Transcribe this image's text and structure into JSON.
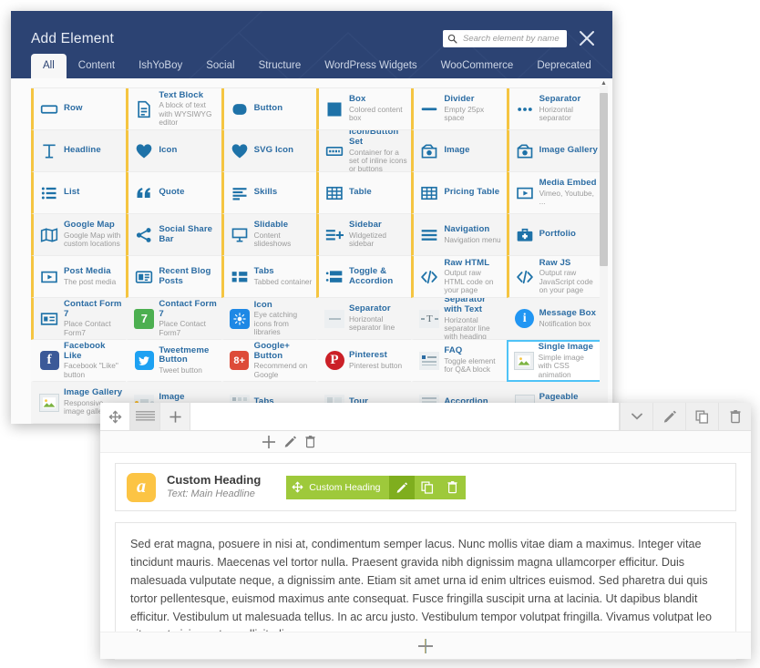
{
  "modal": {
    "title": "Add Element",
    "close_label": "×",
    "close_icon": "close-icon",
    "search": {
      "placeholder": "Search element by name",
      "value": "",
      "icon": "search-icon"
    },
    "tabs": [
      {
        "label": "All",
        "active": true
      },
      {
        "label": "Content",
        "active": false
      },
      {
        "label": "IshYoBoy",
        "active": false
      },
      {
        "label": "Social",
        "active": false
      },
      {
        "label": "Structure",
        "active": false
      },
      {
        "label": "WordPress Widgets",
        "active": false
      },
      {
        "label": "WooCommerce",
        "active": false
      },
      {
        "label": "Deprecated",
        "active": false
      }
    ],
    "accent_color": "#f5c541",
    "header_color": "#2c4373",
    "link_color": "#2b6ca3",
    "selected_outline_color": "#4fc3f7",
    "elements": [
      {
        "name": "Row",
        "desc": "",
        "icon": "row-icon",
        "accent": true
      },
      {
        "name": "Text Block",
        "desc": "A block of text with WYSIWYG editor",
        "icon": "text-block-icon",
        "accent": true
      },
      {
        "name": "Button",
        "desc": "",
        "icon": "button-icon",
        "accent": true
      },
      {
        "name": "Box",
        "desc": "Colored content box",
        "icon": "box-icon",
        "accent": true
      },
      {
        "name": "Divider",
        "desc": "Empty 25px space",
        "icon": "divider-icon",
        "accent": true
      },
      {
        "name": "Separator",
        "desc": "Horizontal separator",
        "icon": "separator-dots-icon",
        "accent": true
      },
      {
        "name": "Headline",
        "desc": "",
        "icon": "headline-icon",
        "accent": true
      },
      {
        "name": "Icon",
        "desc": "",
        "icon": "heart-icon",
        "accent": true
      },
      {
        "name": "SVG Icon",
        "desc": "",
        "icon": "heart-icon",
        "accent": true
      },
      {
        "name": "Icon/Button Set",
        "desc": "Container for a set of inline icons or buttons",
        "icon": "icon-button-set-icon",
        "accent": true
      },
      {
        "name": "Image",
        "desc": "",
        "icon": "image-icon",
        "accent": true
      },
      {
        "name": "Image Gallery",
        "desc": "",
        "icon": "image-icon",
        "accent": true
      },
      {
        "name": "List",
        "desc": "",
        "icon": "list-icon",
        "accent": true
      },
      {
        "name": "Quote",
        "desc": "",
        "icon": "quote-icon",
        "accent": true
      },
      {
        "name": "Skills",
        "desc": "",
        "icon": "skills-icon",
        "accent": true
      },
      {
        "name": "Table",
        "desc": "",
        "icon": "table-icon",
        "accent": true
      },
      {
        "name": "Pricing Table",
        "desc": "",
        "icon": "table-icon",
        "accent": true
      },
      {
        "name": "Media Embed",
        "desc": "Vimeo, Youtube, ...",
        "icon": "play-icon",
        "accent": true
      },
      {
        "name": "Google Map",
        "desc": "Google Map with custom locations",
        "icon": "map-icon",
        "accent": true
      },
      {
        "name": "Social Share Bar",
        "desc": "",
        "icon": "share-icon",
        "accent": true
      },
      {
        "name": "Slidable",
        "desc": "Content slideshows",
        "icon": "slidable-icon",
        "accent": true
      },
      {
        "name": "Sidebar",
        "desc": "Widgetized sidebar",
        "icon": "sidebar-icon",
        "accent": true
      },
      {
        "name": "Navigation",
        "desc": "Navigation menu",
        "icon": "navigation-icon",
        "accent": true
      },
      {
        "name": "Portfolio",
        "desc": "",
        "icon": "portfolio-icon",
        "accent": true
      },
      {
        "name": "Post Media",
        "desc": "The post media",
        "icon": "play-icon",
        "accent": true
      },
      {
        "name": "Recent Blog Posts",
        "desc": "",
        "icon": "blog-icon",
        "accent": true
      },
      {
        "name": "Tabs",
        "desc": "Tabbed container",
        "icon": "tabs-icon",
        "accent": true
      },
      {
        "name": "Toggle & Accordion",
        "desc": "",
        "icon": "accordion-icon",
        "accent": true
      },
      {
        "name": "Raw HTML",
        "desc": "Output raw HTML code on your page",
        "icon": "code-icon",
        "accent": true
      },
      {
        "name": "Raw JS",
        "desc": "Output raw JavaScript code on your page",
        "icon": "code-icon",
        "accent": true
      },
      {
        "name": "Contact Form 7",
        "desc": "Place Contact Form7",
        "icon": "contact-form-icon",
        "accent": true
      },
      {
        "name": "Contact Form 7",
        "desc": "Place Contact Form7",
        "icon": "cf7-green-icon",
        "accent": false
      },
      {
        "name": "Icon",
        "desc": "Eye catching icons from libraries",
        "icon": "icon-blue-icon",
        "accent": false
      },
      {
        "name": "Separator",
        "desc": "Horizontal separator line",
        "icon": "separator-line-icon",
        "accent": false
      },
      {
        "name": "Separator with Text",
        "desc": "Horizontal separator line with heading",
        "icon": "separator-text-icon",
        "accent": false
      },
      {
        "name": "Message Box",
        "desc": "Notification box",
        "icon": "info-icon",
        "accent": false
      },
      {
        "name": "Facebook Like",
        "desc": "Facebook \"Like\" button",
        "icon": "facebook-icon",
        "accent": false
      },
      {
        "name": "Tweetmeme Button",
        "desc": "Tweet button",
        "icon": "twitter-icon",
        "accent": false
      },
      {
        "name": "Google+ Button",
        "desc": "Recommend on Google",
        "icon": "googleplus-icon",
        "accent": false
      },
      {
        "name": "Pinterest",
        "desc": "Pinterest button",
        "icon": "pinterest-icon",
        "accent": false
      },
      {
        "name": "FAQ",
        "desc": "Toggle element for Q&A block",
        "icon": "faq-icon",
        "accent": false
      },
      {
        "name": "Single Image",
        "desc": "Simple image with CSS animation",
        "icon": "single-image-icon",
        "accent": false,
        "selected": true
      },
      {
        "name": "Image Gallery",
        "desc": "Responsive image gallery",
        "icon": "gallery-icon",
        "accent": false
      },
      {
        "name": "Image Carousel",
        "desc": "",
        "icon": "carousel-icon",
        "accent": false
      },
      {
        "name": "Tabs",
        "desc": "",
        "icon": "tabs-grey-icon",
        "accent": false
      },
      {
        "name": "Tour",
        "desc": "",
        "icon": "tour-icon",
        "accent": false
      },
      {
        "name": "Accordion",
        "desc": "",
        "icon": "accordion-grey-icon",
        "accent": false
      },
      {
        "name": "Pageable Container",
        "desc": "",
        "icon": "pageable-icon",
        "accent": false
      }
    ]
  },
  "editor": {
    "toolbar_left": [
      {
        "name": "move-handle",
        "icon": "move-icon"
      },
      {
        "name": "row-layout",
        "icon": "rows-icon"
      },
      {
        "name": "add-element",
        "icon": "plus-icon"
      }
    ],
    "toolbar_right": [
      {
        "name": "dropdown",
        "icon": "chevron-down-icon"
      },
      {
        "name": "edit",
        "icon": "pencil-icon"
      },
      {
        "name": "clone",
        "icon": "copy-icon"
      },
      {
        "name": "delete",
        "icon": "trash-icon"
      }
    ],
    "row_tools": [
      {
        "name": "add",
        "icon": "plus-icon"
      },
      {
        "name": "edit",
        "icon": "pencil-icon"
      },
      {
        "name": "delete",
        "icon": "trash-icon"
      }
    ],
    "element": {
      "badge_letter": "a",
      "badge_color": "#fcc444",
      "title": "Custom Heading",
      "subtitle": "Text: Main Headline",
      "action_label": "Custom Heading",
      "action_color": "#9ec93b",
      "actions": [
        {
          "name": "drag",
          "icon": "move-icon"
        },
        {
          "name": "edit",
          "icon": "pencil-icon"
        },
        {
          "name": "clone",
          "icon": "copy-icon"
        },
        {
          "name": "delete",
          "icon": "trash-icon"
        }
      ]
    },
    "body_text": "Sed erat magna, posuere in nisi at, condimentum semper lacus. Nunc mollis vitae diam a maximus. Integer vitae tincidunt mauris. Maecenas vel tortor nulla. Praesent gravida nibh dignissim magna ullamcorper efficitur. Duis malesuada vulputate neque, a dignissim ante. Etiam sit amet urna id enim ultrices euismod. Sed pharetra dui quis tortor pellentesque, euismod maximus ante consequat. Fusce fringilla suscipit urna at lacinia. Ut dapibus blandit efficitur. Vestibulum ut malesuada tellus. In ac arcu justo. Vestibulum tempor volutpat fringilla. Vivamus volutpat leo sit amet nisi egestas sollicitudin.",
    "footer_add": {
      "name": "add-row",
      "icon": "plus-icon"
    }
  }
}
